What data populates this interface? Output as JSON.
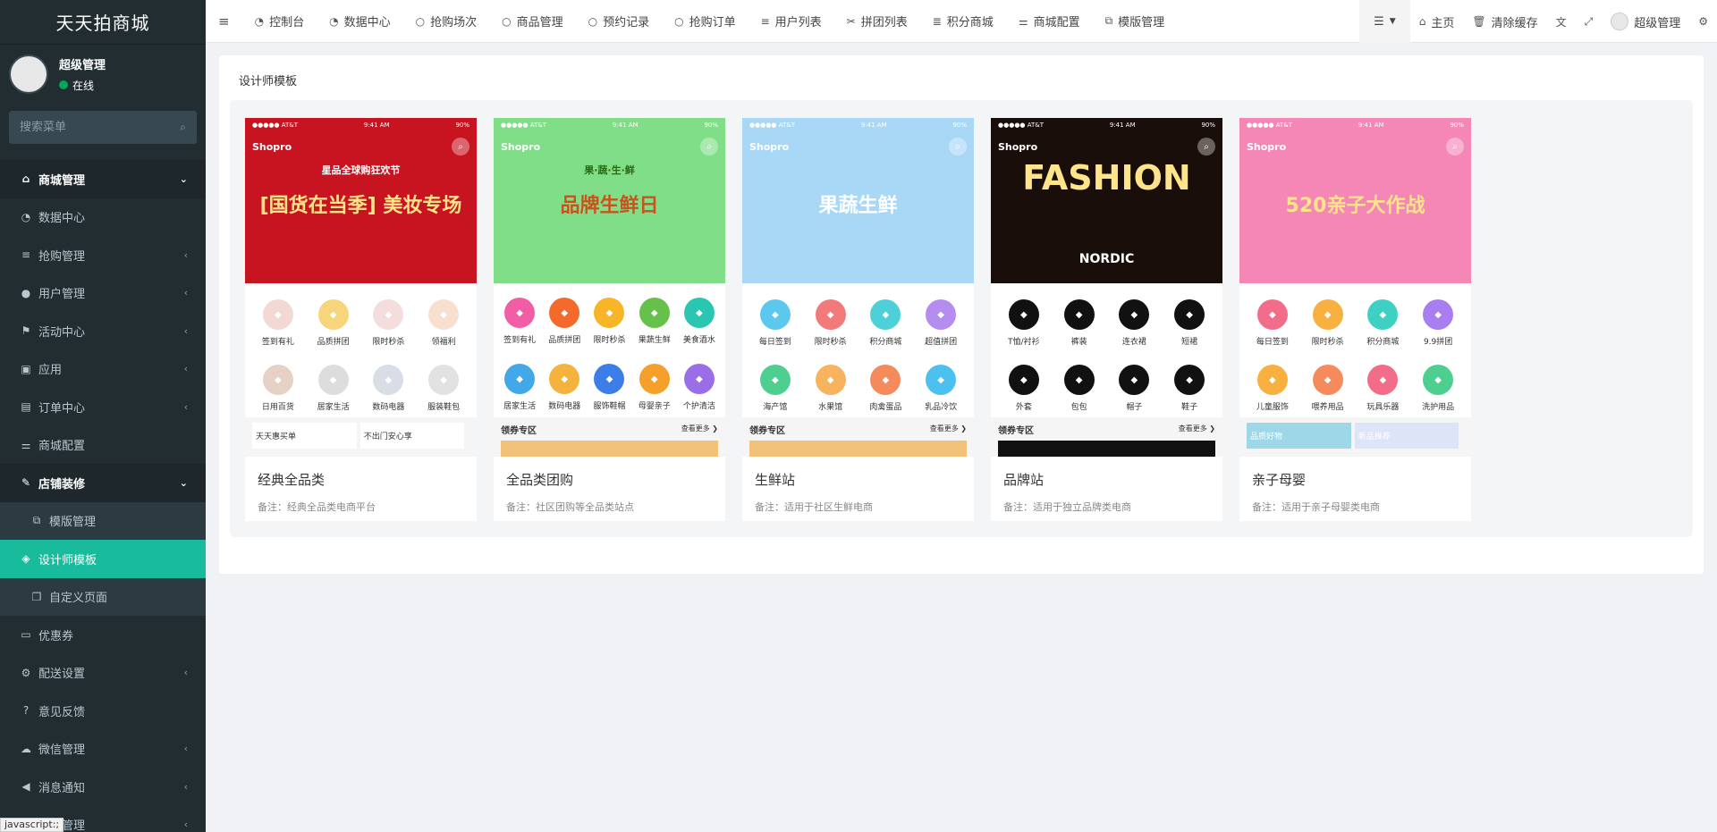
{
  "sidebar": {
    "logo": "天天拍商城",
    "user": {
      "name": "超级管理",
      "status": "在线"
    },
    "search_placeholder": "搜索菜单",
    "items": [
      {
        "icon": "⌂",
        "icon_name": "home-icon",
        "label": "商城管理",
        "state": "open"
      },
      {
        "icon": "◔",
        "icon_name": "dashboard-icon",
        "label": "数据中心"
      },
      {
        "icon": "≡",
        "icon_name": "list-icon",
        "label": "抢购管理",
        "arrow": "‹"
      },
      {
        "icon": "●",
        "icon_name": "user-icon",
        "label": "用户管理",
        "arrow": "‹"
      },
      {
        "icon": "⚑",
        "icon_name": "flag-icon",
        "label": "活动中心",
        "arrow": "‹"
      },
      {
        "icon": "▣",
        "icon_name": "briefcase-icon",
        "label": "应用",
        "arrow": "‹"
      },
      {
        "icon": "▤",
        "icon_name": "file-icon",
        "label": "订单中心",
        "arrow": "‹"
      },
      {
        "icon": "⚌",
        "icon_name": "sliders-icon",
        "label": "商城配置"
      },
      {
        "icon": "✎",
        "icon_name": "brush-icon",
        "label": "店铺装修",
        "state": "open"
      },
      {
        "icon": "⧉",
        "icon_name": "cubes-icon",
        "label": "模版管理",
        "state": "sub"
      },
      {
        "icon": "◈",
        "icon_name": "cube-icon",
        "label": "设计师模板",
        "state": "active"
      },
      {
        "icon": "❐",
        "icon_name": "copy-icon",
        "label": "自定义页面",
        "state": "sub"
      },
      {
        "icon": "▭",
        "icon_name": "money-icon",
        "label": "优惠券"
      },
      {
        "icon": "⚙",
        "icon_name": "gears-icon",
        "label": "配送设置",
        "arrow": "‹"
      },
      {
        "icon": "?",
        "icon_name": "question-icon",
        "label": "意见反馈"
      },
      {
        "icon": "☁",
        "icon_name": "wechat-icon",
        "label": "微信管理",
        "arrow": "‹"
      },
      {
        "icon": "◀",
        "icon_name": "bullhorn-icon",
        "label": "消息通知",
        "arrow": "‹"
      },
      {
        "icon": "▦",
        "icon_name": "goods-icon",
        "label": "商品管理",
        "arrow": "‹"
      }
    ]
  },
  "topbar": {
    "nav": [
      {
        "icon": "◔",
        "icon_name": "dashboard-icon",
        "label": "控制台"
      },
      {
        "icon": "◔",
        "icon_name": "dashboard-icon",
        "label": "数据中心"
      },
      {
        "icon": "○",
        "icon_name": "circle-icon",
        "label": "抢购场次"
      },
      {
        "icon": "○",
        "icon_name": "circle-icon",
        "label": "商品管理"
      },
      {
        "icon": "○",
        "icon_name": "circle-icon",
        "label": "预约记录"
      },
      {
        "icon": "○",
        "icon_name": "circle-icon",
        "label": "抢购订单"
      },
      {
        "icon": "≡",
        "icon_name": "list-icon",
        "label": "用户列表"
      },
      {
        "icon": "✂",
        "icon_name": "group-icon",
        "label": "拼团列表"
      },
      {
        "icon": "≣",
        "icon_name": "database-icon",
        "label": "积分商城"
      },
      {
        "icon": "⚌",
        "icon_name": "sliders-icon",
        "label": "商城配置"
      },
      {
        "icon": "⧉",
        "icon_name": "cubes-icon",
        "label": "模版管理"
      }
    ],
    "right": {
      "home": "主页",
      "clear_cache": "清除缓存",
      "admin": "超级管理"
    }
  },
  "page": {
    "title": "设计师模板"
  },
  "templates": [
    {
      "title": "经典全品类",
      "note": "备注：经典全品类电商平台",
      "shop": "Shopro",
      "time": "9:41 AM",
      "carrier": "●●●●● AT&T",
      "battery": "90%",
      "banner_color": "#c81420",
      "banner_text": "[国货在当季] 美妆专场",
      "banner_sub": "星品全球购狂欢节",
      "strip_label": "",
      "strip_more": "",
      "strip_items": [
        "天天惠买单",
        "不出门安心享"
      ],
      "icons": [
        {
          "label": "签到有礼",
          "color": "#f3d9d4"
        },
        {
          "label": "品质拼团",
          "color": "#f7d57a"
        },
        {
          "label": "限时秒杀",
          "color": "#f4dddd"
        },
        {
          "label": "领福利",
          "color": "#f8e0d0"
        },
        {
          "label": "日用百货",
          "color": "#e6d2c4"
        },
        {
          "label": "居家生活",
          "color": "#dddddd"
        },
        {
          "label": "数码电器",
          "color": "#d8dde6"
        },
        {
          "label": "服装鞋包",
          "color": "#e2e2e2"
        }
      ]
    },
    {
      "title": "全品类团购",
      "note": "备注：社区团购等全品类站点",
      "shop": "Shopro",
      "time": "9:41 AM",
      "carrier": "●●●●● AT&T",
      "battery": "90%",
      "banner_color": "#7fde87",
      "banner_text": "品牌生鲜日",
      "banner_sub": "果·蔬·生·鲜",
      "strip_label": "领券专区",
      "strip_more": "查看更多 ❯",
      "strip_items": [],
      "icons": [
        {
          "label": "签到有礼",
          "color": "#f25ea6"
        },
        {
          "label": "品质拼团",
          "color": "#f46a2c"
        },
        {
          "label": "限时秒杀",
          "color": "#f8b528"
        },
        {
          "label": "果蔬生鲜",
          "color": "#66c14a"
        },
        {
          "label": "美食酒水",
          "color": "#2bc6b2"
        },
        {
          "label": "居家生活",
          "color": "#42a8e8"
        },
        {
          "label": "数码电器",
          "color": "#f4b33d"
        },
        {
          "label": "服饰鞋帽",
          "color": "#3c7de8"
        },
        {
          "label": "母婴亲子",
          "color": "#f6a02c"
        },
        {
          "label": "个护清洁",
          "color": "#9a6ee6"
        }
      ]
    },
    {
      "title": "生鲜站",
      "note": "备注：适用于社区生鲜电商",
      "shop": "Shopro",
      "time": "9:41 AM",
      "carrier": "●●●●● AT&T",
      "battery": "90%",
      "banner_color": "#a9d8f7",
      "banner_text": "果蔬生鲜",
      "banner_sub": "",
      "strip_label": "领券专区",
      "strip_more": "查看更多 ❯",
      "strip_items": [],
      "icons": [
        {
          "label": "每日签到",
          "color": "#5cc8ee"
        },
        {
          "label": "限时秒杀",
          "color": "#f27a7a"
        },
        {
          "label": "积分商城",
          "color": "#4ed0d8"
        },
        {
          "label": "超值拼团",
          "color": "#b58cf0"
        },
        {
          "label": "海产馆",
          "color": "#4ecf90"
        },
        {
          "label": "水果馆",
          "color": "#f8b35e"
        },
        {
          "label": "肉禽蛋品",
          "color": "#f58a5c"
        },
        {
          "label": "乳品冷饮",
          "color": "#4cc1f0"
        }
      ]
    },
    {
      "title": "品牌站",
      "note": "备注：适用于独立品牌类电商",
      "shop": "Shopro",
      "time": "9:41 AM",
      "carrier": "●●●●● AT&T",
      "battery": "90%",
      "banner_color": "#1a0e0a",
      "banner_text": "FASHION",
      "banner_sub": "NORDIC",
      "strip_label": "领券专区",
      "strip_more": "查看更多 ❯",
      "strip_items": [],
      "icons": [
        {
          "label": "T恤/衬衫",
          "color": "#111111"
        },
        {
          "label": "裤装",
          "color": "#111111"
        },
        {
          "label": "连衣裙",
          "color": "#111111"
        },
        {
          "label": "短裙",
          "color": "#111111"
        },
        {
          "label": "外套",
          "color": "#111111"
        },
        {
          "label": "包包",
          "color": "#111111"
        },
        {
          "label": "帽子",
          "color": "#111111"
        },
        {
          "label": "鞋子",
          "color": "#111111"
        }
      ]
    },
    {
      "title": "亲子母婴",
      "note": "备注：适用于亲子母婴类电商",
      "shop": "Shopro",
      "time": "9:41 AM",
      "carrier": "●●●●● AT&T",
      "battery": "90%",
      "banner_color": "#f487b6",
      "banner_text": "520亲子大作战",
      "banner_sub": "",
      "strip_label": "",
      "strip_more": "",
      "strip_items": [
        "品质好物",
        "新品推荐"
      ],
      "icons": [
        {
          "label": "每日签到",
          "color": "#f26d8a"
        },
        {
          "label": "限时秒杀",
          "color": "#f8b040"
        },
        {
          "label": "积分商城",
          "color": "#3fd0c4"
        },
        {
          "label": "9.9拼团",
          "color": "#a97ef0"
        },
        {
          "label": "儿童服饰",
          "color": "#f8b040"
        },
        {
          "label": "喂养用品",
          "color": "#f58a5c"
        },
        {
          "label": "玩具乐器",
          "color": "#f26d8a"
        },
        {
          "label": "洗护用品",
          "color": "#4ecf90"
        }
      ]
    }
  ],
  "statusbar": {
    "text": "javascript:;"
  }
}
